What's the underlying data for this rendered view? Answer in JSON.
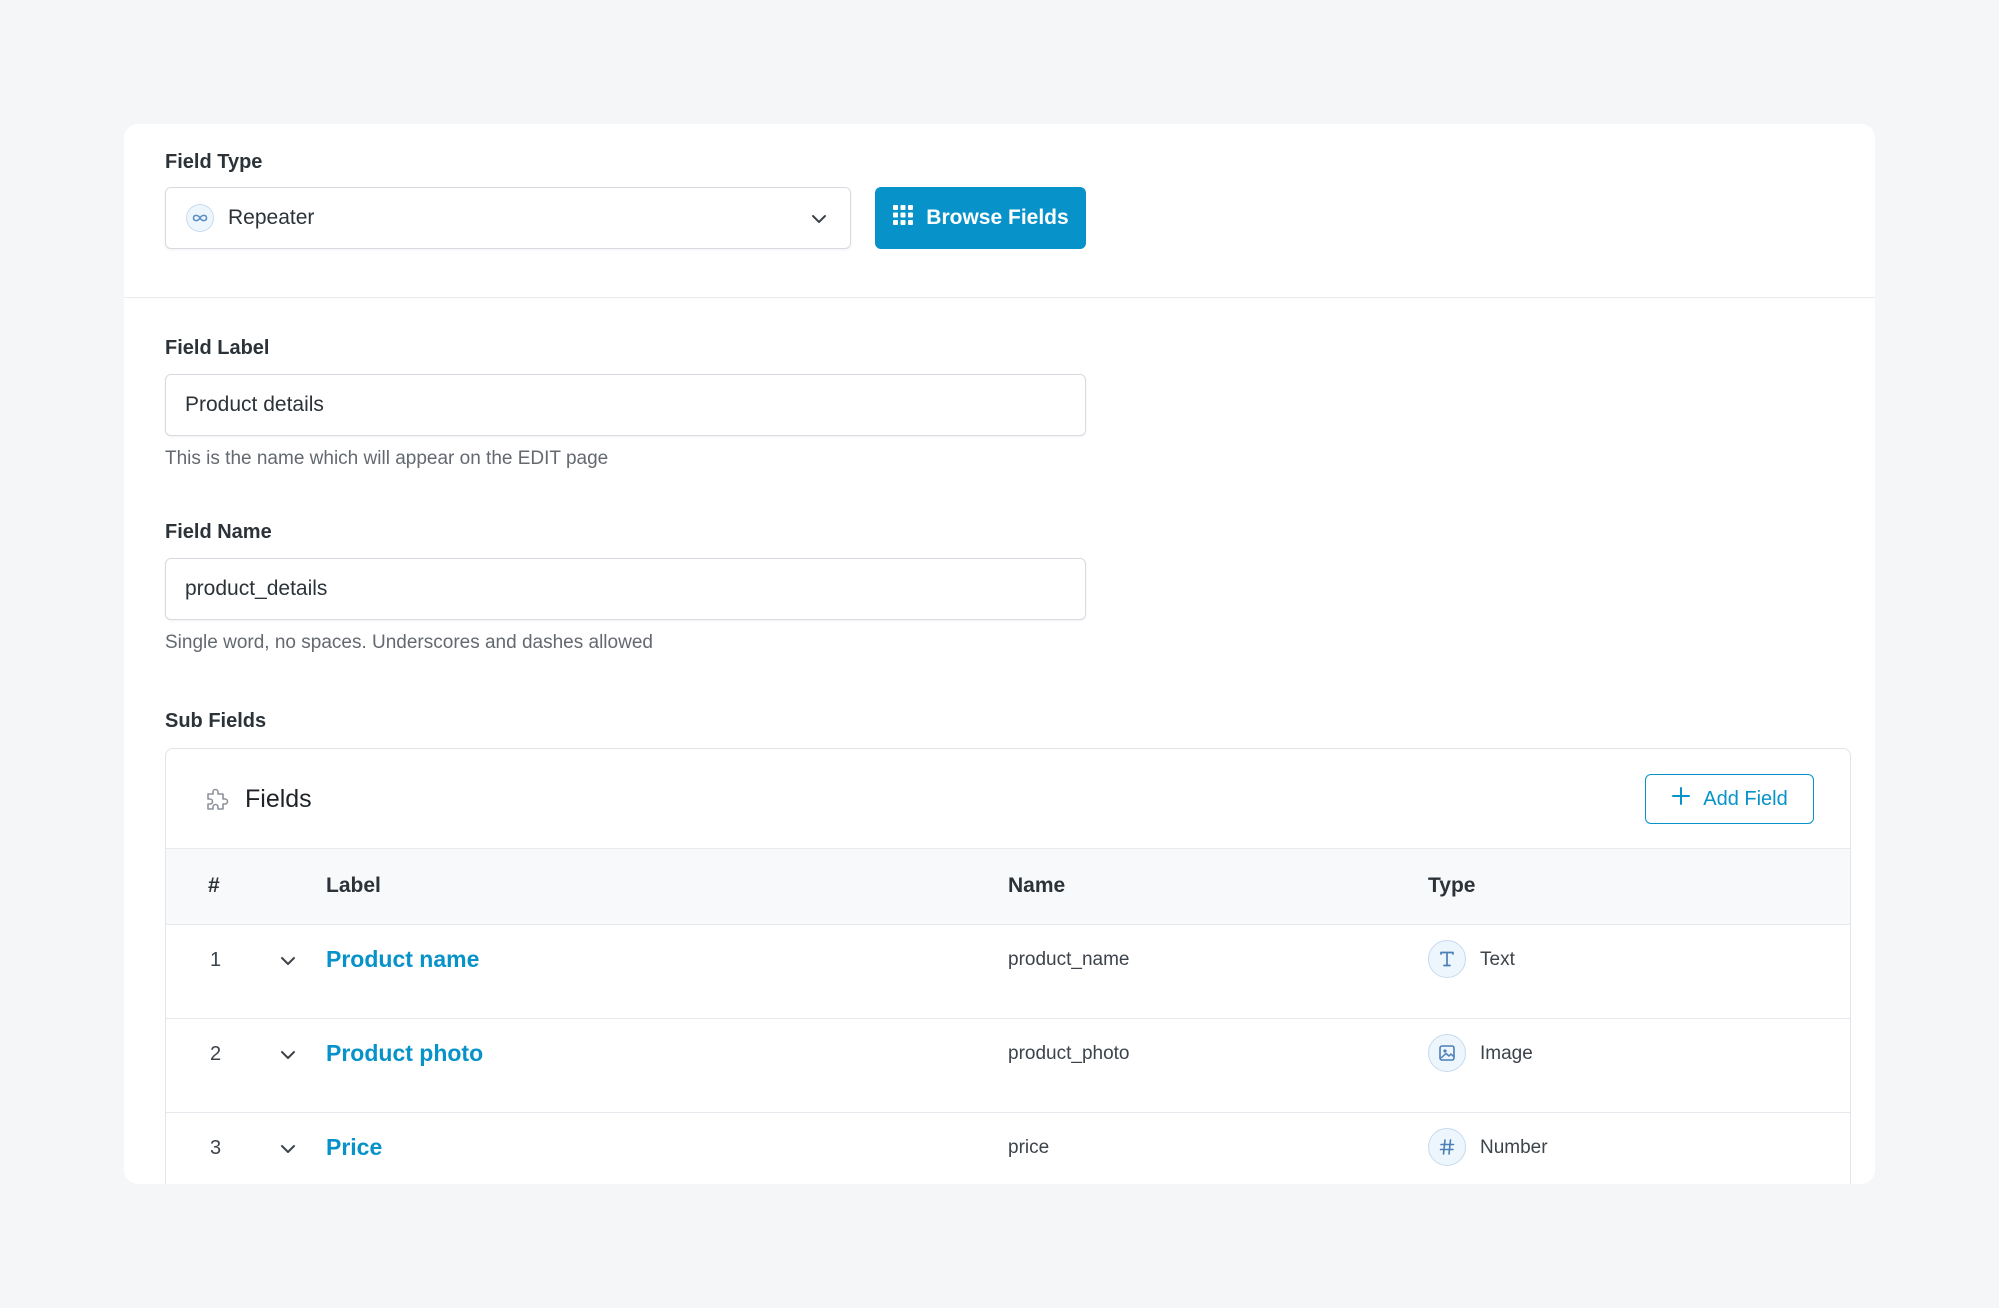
{
  "field_type": {
    "label": "Field Type",
    "selected": "Repeater",
    "icon": "infinity-icon",
    "browse_button": "Browse Fields"
  },
  "field_label": {
    "label": "Field Label",
    "value": "Product details",
    "hint": "This is the name which will appear on the EDIT page"
  },
  "field_name": {
    "label": "Field Name",
    "value": "product_details",
    "hint": "Single word, no spaces. Underscores and dashes allowed"
  },
  "sub_fields": {
    "label": "Sub Fields",
    "panel_title": "Fields",
    "add_button": "Add Field",
    "columns": {
      "num": "#",
      "label": "Label",
      "name": "Name",
      "type": "Type"
    },
    "rows": [
      {
        "num": "1",
        "label": "Product name",
        "name": "product_name",
        "type": "Text",
        "type_icon": "text-icon"
      },
      {
        "num": "2",
        "label": "Product photo",
        "name": "product_photo",
        "type": "Image",
        "type_icon": "image-icon"
      },
      {
        "num": "3",
        "label": "Price",
        "name": "price",
        "type": "Number",
        "type_icon": "hash-icon"
      }
    ]
  },
  "colors": {
    "accent": "#0793c9",
    "background": "#f5f6f8",
    "card": "#ffffff"
  }
}
